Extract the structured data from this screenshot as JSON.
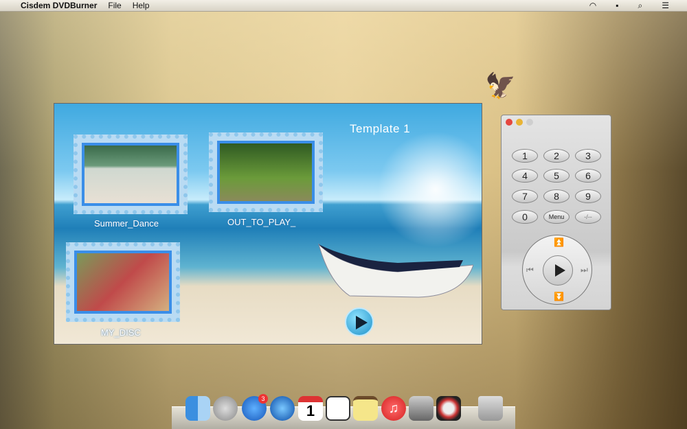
{
  "menubar": {
    "app": "Cisdem DVDBurner",
    "items": [
      "File",
      "Help"
    ],
    "status_icons": [
      "wifi-icon",
      "flag-icon",
      "search-icon",
      "list-icon"
    ]
  },
  "preview": {
    "title": "Template 1",
    "titles": [
      {
        "label": "Summer_Dance"
      },
      {
        "label": "OUT_TO_PLAY_"
      },
      {
        "label": "MY_DISC"
      }
    ],
    "play_icon": "play-icon"
  },
  "remote": {
    "buttons": [
      "1",
      "2",
      "3",
      "4",
      "5",
      "6",
      "7",
      "8",
      "9",
      "0",
      "Menu",
      "-/--"
    ]
  },
  "dock": {
    "badge": "3",
    "apps": [
      "finder",
      "launchpad",
      "app-store",
      "safari",
      "calendar",
      "reminders",
      "notes",
      "itunes",
      "system-preferences",
      "dvd-burner",
      "trash"
    ],
    "calendar_day": "1"
  }
}
